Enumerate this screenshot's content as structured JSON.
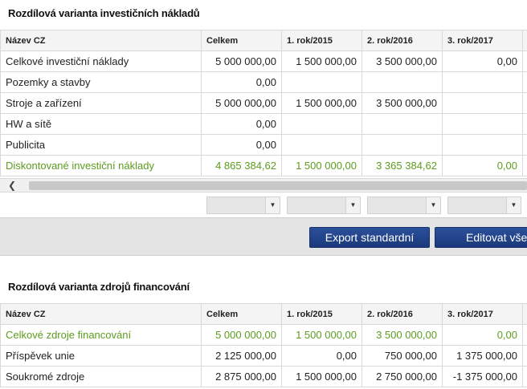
{
  "section1": {
    "title": "Rozdílová varianta investičních nákladů",
    "headers": [
      "Název CZ",
      "Celkem",
      "1. rok/2015",
      "2. rok/2016",
      "3. rok/2017"
    ],
    "rows": [
      {
        "name": "Celkové investiční náklady",
        "total": "5 000 000,00",
        "y1": "1 500 000,00",
        "y2": "3 500 000,00",
        "y3": "0,00",
        "green": false
      },
      {
        "name": "Pozemky a stavby",
        "total": "0,00",
        "y1": "",
        "y2": "",
        "y3": "",
        "green": false
      },
      {
        "name": "Stroje a zařízení",
        "total": "5 000 000,00",
        "y1": "1 500 000,00",
        "y2": "3 500 000,00",
        "y3": "",
        "green": false
      },
      {
        "name": "HW a sítě",
        "total": "0,00",
        "y1": "",
        "y2": "",
        "y3": "",
        "green": false
      },
      {
        "name": "Publicita",
        "total": "0,00",
        "y1": "",
        "y2": "",
        "y3": "",
        "green": false
      },
      {
        "name": "Diskontované investiční náklady",
        "total": "4 865 384,62",
        "y1": "1 500 000,00",
        "y2": "3 365 384,62",
        "y3": "0,00",
        "green": true
      }
    ]
  },
  "toolbar": {
    "export_label": "Export standardní",
    "edit_label": "Editovat vše"
  },
  "section2": {
    "title": "Rozdílová varianta zdrojů financování",
    "headers": [
      "Název CZ",
      "Celkem",
      "1. rok/2015",
      "2. rok/2016",
      "3. rok/2017"
    ],
    "rows": [
      {
        "name": "Celkové zdroje financování",
        "total": "5 000 000,00",
        "y1": "1 500 000,00",
        "y2": "3 500 000,00",
        "y3": "0,00",
        "green": true
      },
      {
        "name": "Příspěvek unie",
        "total": "2 125 000,00",
        "y1": "0,00",
        "y2": "750 000,00",
        "y3": "1 375 000,00",
        "green": false
      },
      {
        "name": "Soukromé zdroje",
        "total": "2 875 000,00",
        "y1": "1 500 000,00",
        "y2": "2 750 000,00",
        "y3": "-1 375 000,00",
        "green": false
      }
    ]
  },
  "colors": {
    "green_text": "#5c9c1e",
    "button_blue": "#1f3f86"
  }
}
